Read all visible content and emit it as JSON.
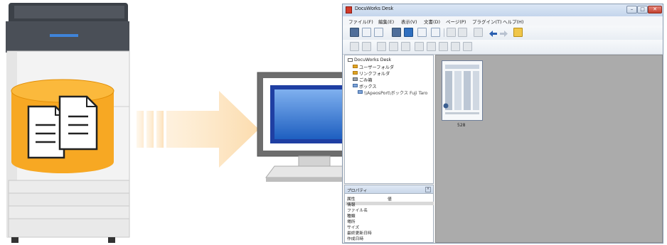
{
  "window": {
    "title": "DocuWorks Desk",
    "menu": [
      "ファイル(F)",
      "編集(E)",
      "表示(V)",
      "文書(D)",
      "ページ(P)",
      "プラグイン(T)",
      "ヘルプ(H)"
    ]
  },
  "tree": {
    "items": [
      {
        "label": "DocuWorks Desk",
        "icon": "desk-icon"
      },
      {
        "label": "ユーザーフォルダ",
        "icon": "folder-icon"
      },
      {
        "label": "リンクフォルダ",
        "icon": "folder-icon"
      },
      {
        "label": "ごみ箱",
        "icon": "trash-icon"
      },
      {
        "label": "ボックス",
        "icon": "box-icon"
      },
      {
        "label": "\\\\ApeosPort\\ボックス Fuji Taro",
        "icon": "network-box-icon"
      }
    ]
  },
  "properties": {
    "title": "プロパティ",
    "columns": [
      "属性",
      "値"
    ],
    "rows": [
      "情報",
      "ファイル名",
      "種類",
      "場所",
      "サイズ",
      "最終更新日時",
      "作成日時"
    ]
  },
  "document": {
    "label": "528"
  },
  "colors": {
    "arrow": "#fde2b8",
    "database": "#f7a823",
    "monitor_frame": "#6d6d6d",
    "screen": "#2a6fd1",
    "docview_bg": "#ababab"
  }
}
